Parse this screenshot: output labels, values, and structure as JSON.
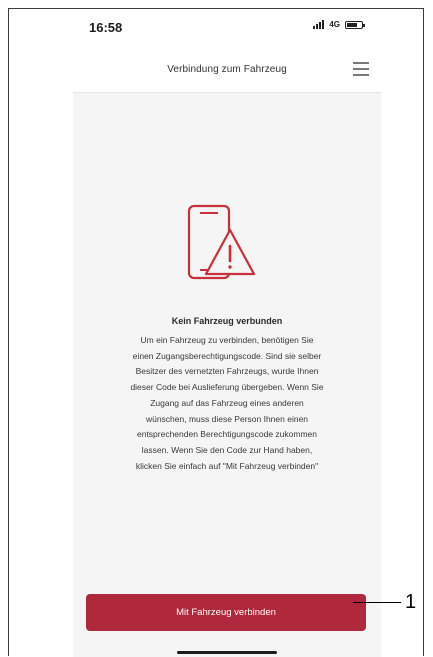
{
  "statusbar": {
    "time": "16:58",
    "network": "4G",
    "icons": [
      "signal-icon",
      "battery-icon"
    ]
  },
  "header": {
    "title": "Verbindung zum Fahrzeug",
    "menu_icon": "hamburger-menu-icon"
  },
  "illustration": {
    "icon": "phone-warning-icon",
    "color": "#c8303c"
  },
  "message": {
    "title": "Kein Fahrzeug verbunden",
    "lines": [
      "Um ein Fahrzeug zu verbinden, benötigen Sie",
      "einen Zugangsberechtigungscode. Sind sie selber",
      "Besitzer des vernetzten Fahrzeugs, wurde Ihnen",
      "dieser Code bei Auslieferung übergeben. Wenn Sie",
      "Zugang auf das Fahrzeug eines anderen",
      "wünschen,  muss diese Person Ihnen einen",
      "entsprechenden Berechtigungscode zukommen",
      "lassen. Wenn Sie den Code zur Hand haben,",
      "klicken Sie einfach auf \"Mit Fahrzeug verbinden\""
    ]
  },
  "actions": {
    "connect_label": "Mit Fahrzeug verbinden",
    "connect_color": "#b0283b"
  },
  "annotation": {
    "callout_number": "1"
  }
}
